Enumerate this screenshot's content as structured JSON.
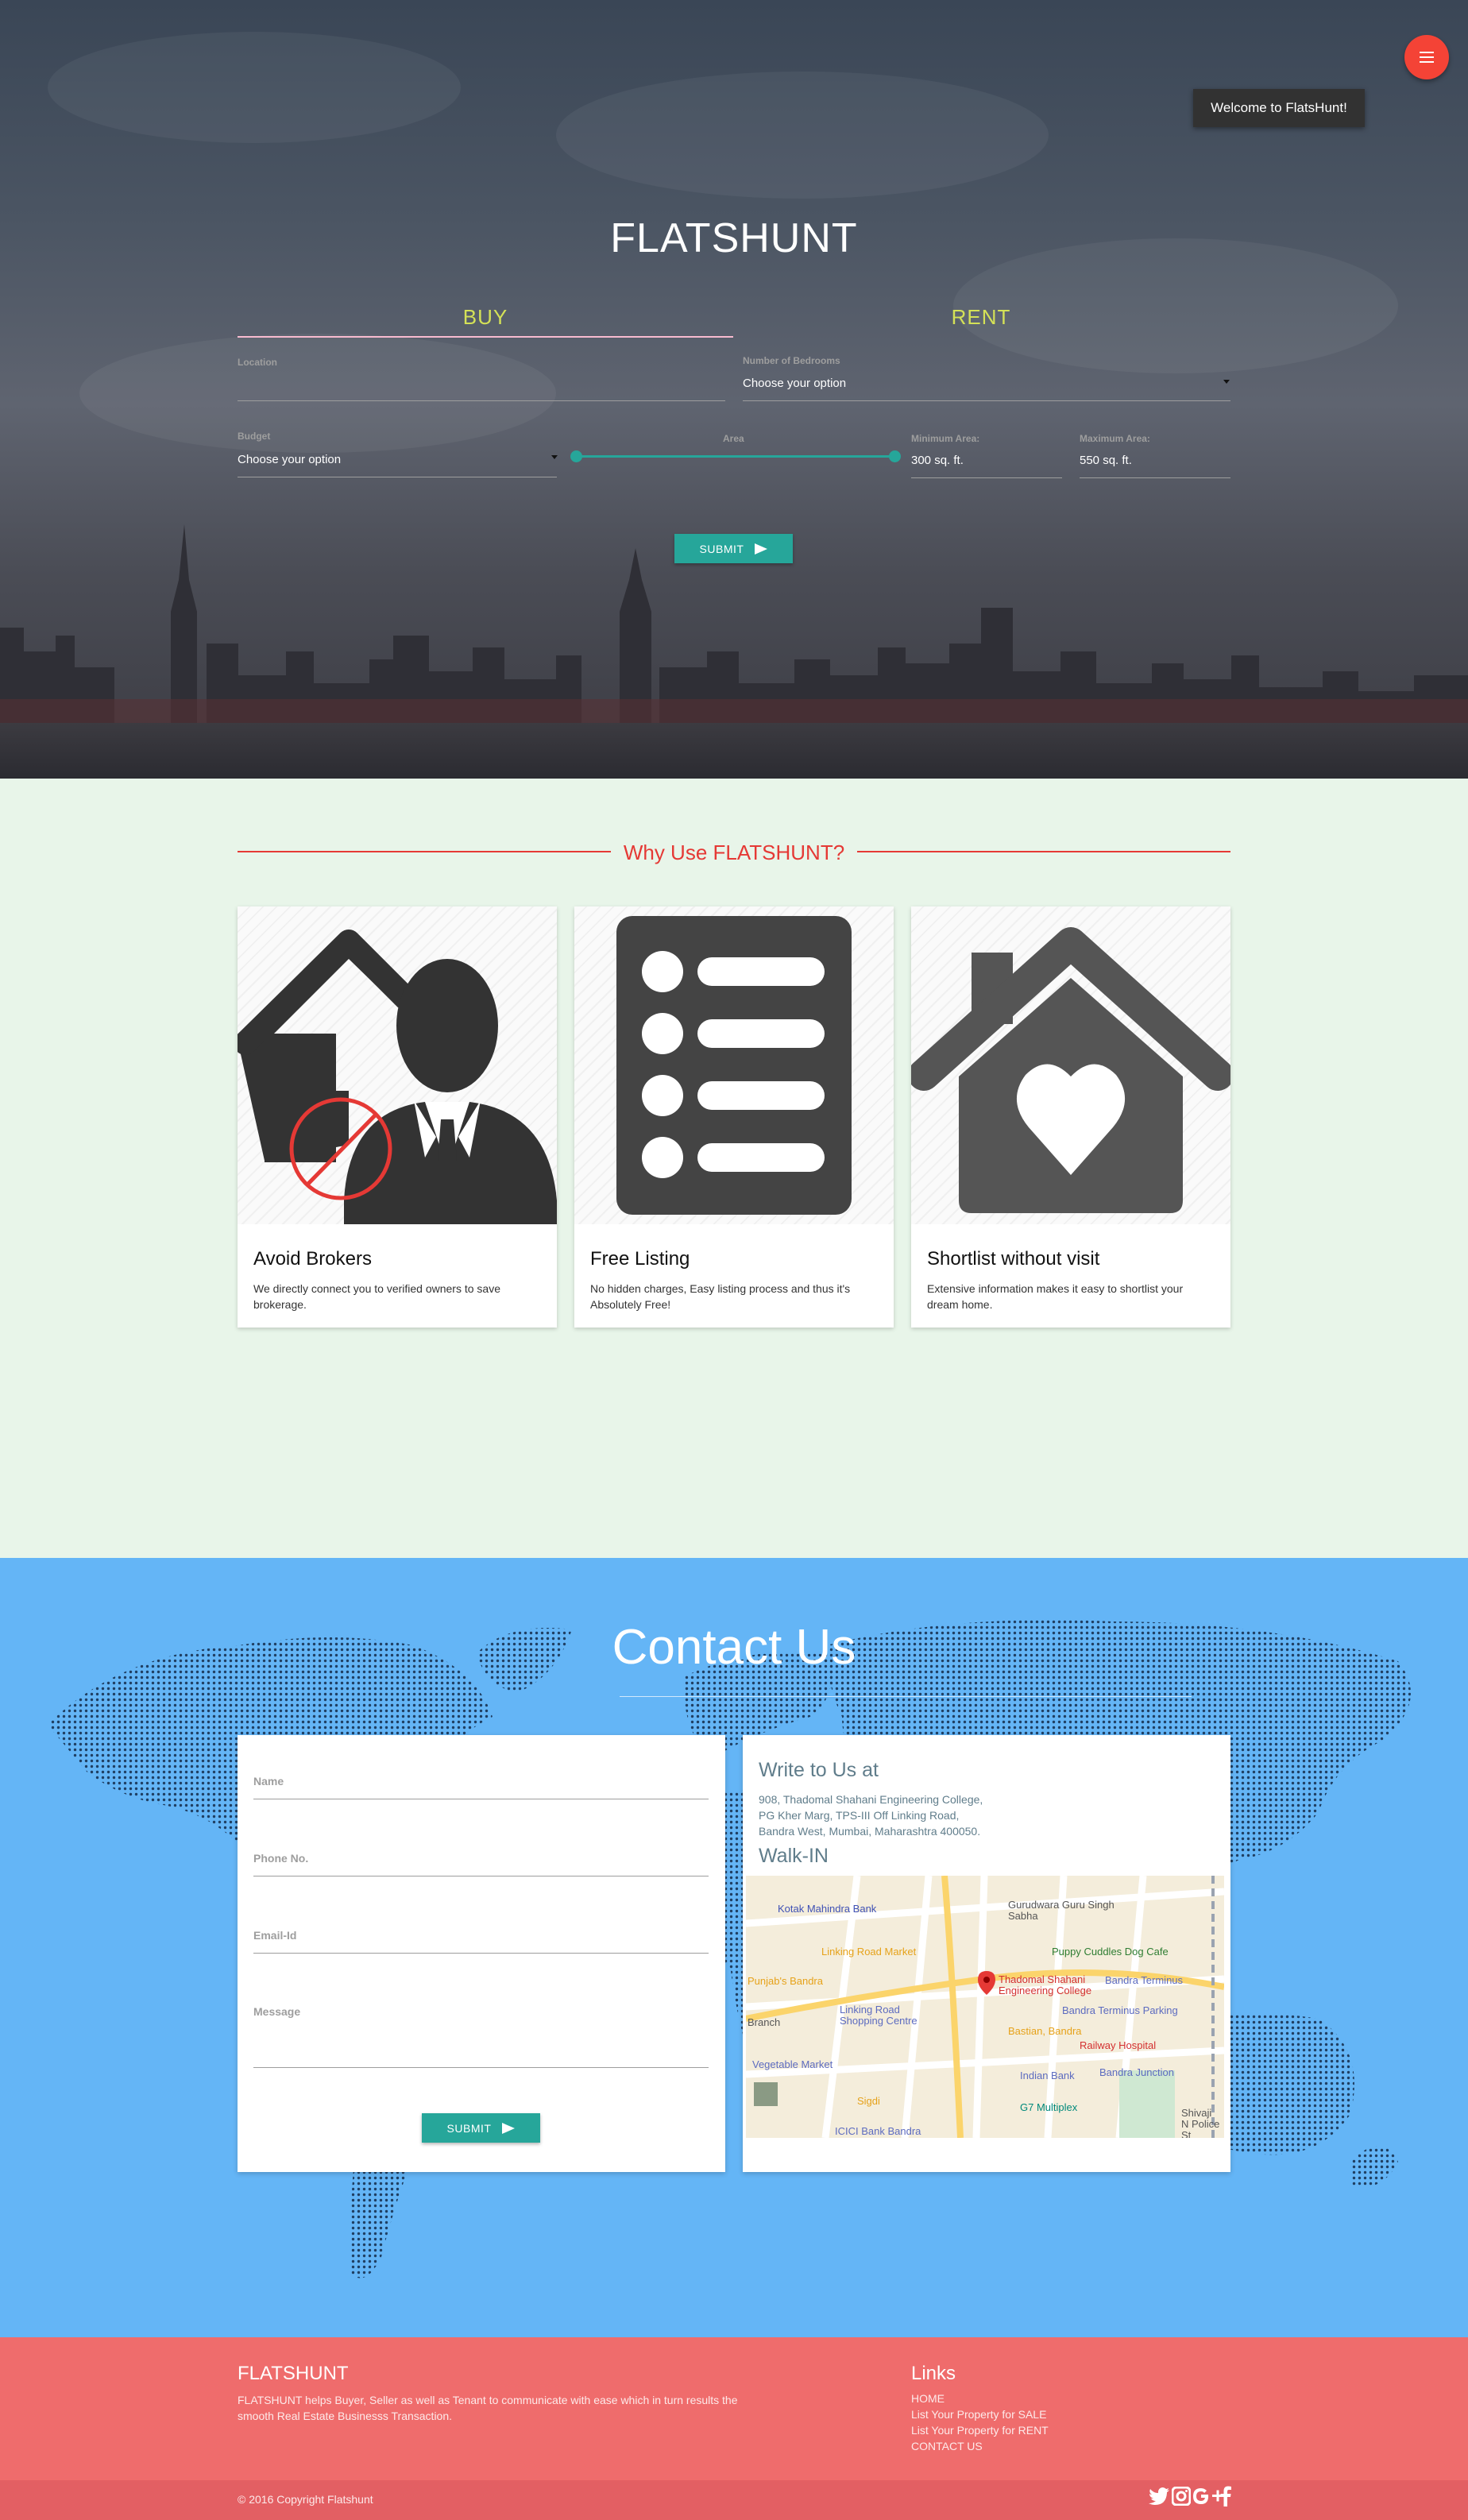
{
  "notification": "Welcome to FlatsHunt!",
  "hero": {
    "brand": "FLATSHUNT",
    "tabs": [
      "BUY",
      "RENT"
    ],
    "location_label": "Location",
    "bedrooms_label": "Number of Bedrooms",
    "bedrooms_value": "Choose your option",
    "budget_label": "Budget",
    "budget_value": "Choose your option",
    "area_label": "Area",
    "min_area_label": "Minimum Area:",
    "min_area_value": "300 sq. ft.",
    "max_area_label": "Maximum Area:",
    "max_area_value": "550 sq. ft.",
    "submit": "SUBMIT"
  },
  "why": {
    "title": "Why Use FLATSHUNT?",
    "cards": [
      {
        "icon": "broker-icon",
        "title": "Avoid Brokers",
        "text": "We directly connect you to verified owners to save brokerage."
      },
      {
        "icon": "list-icon",
        "title": "Free Listing",
        "text": "No hidden charges, Easy listing process and thus it's Absolutely Free!"
      },
      {
        "icon": "house-heart-icon",
        "title": "Shortlist without visit",
        "text": "Extensive information makes it easy to shortlist your dream home."
      }
    ]
  },
  "contact": {
    "title": "Contact Us",
    "form": {
      "name": "Name",
      "phone": "Phone No.",
      "email": "Email-Id",
      "message": "Message",
      "submit": "SUBMIT"
    },
    "write_title": "Write to Us at",
    "address": [
      "908, Thadomal Shahani Engineering College,",
      "PG Kher Marg, TPS-III Off Linking Road,",
      "Bandra West, Mumbai, Maharashtra 400050."
    ],
    "walk_in": "Walk-IN",
    "map_labels": {
      "kotak": "Kotak Mahindra Bank",
      "gurudwara": "Gurudwara Guru Singh Sabha",
      "linking_market": "Linking Road Market",
      "puppy": "Puppy Cuddles Dog Cafe",
      "punjabs": "Punjab's Bandra",
      "college": "Thadomal Shahani Engineering College",
      "terminus": "Bandra Terminus",
      "linking_centre": "Linking Road Shopping Centre",
      "terminus_parking": "Bandra Terminus Parking",
      "bastian": "Bastian, Bandra",
      "railway": "Railway Hospital",
      "branch": "Branch",
      "indian_bank": "Indian Bank",
      "junction": "Bandra Junction",
      "veg_market": "Vegetable Market",
      "sigdi": "Sigdi",
      "multiplex": "G7 Multiplex",
      "icici": "ICICI Bank Bandra",
      "shivaji": "Shivaji N Police St"
    }
  },
  "footer": {
    "brand": "FLATSHUNT",
    "description": "FLATSHUNT helps Buyer, Seller as well as Tenant to communicate with ease which in turn results the smooth Real Estate Businesss Transaction.",
    "links_title": "Links",
    "links": [
      "HOME",
      "List Your Property for SALE",
      "List Your Property for RENT",
      "CONTACT US"
    ],
    "copyright": "© 2016 Copyright Flatshunt",
    "social": [
      "twitter-icon",
      "instagram-icon",
      "google-plus-icon",
      "facebook-icon"
    ]
  },
  "colors": {
    "accent_teal": "#26a69a",
    "tab_yellow": "#d4e157",
    "fab_red": "#f44336",
    "why_red": "#e53935",
    "contact_blue": "#64b5f6",
    "footer_red": "#ef6c6c"
  }
}
